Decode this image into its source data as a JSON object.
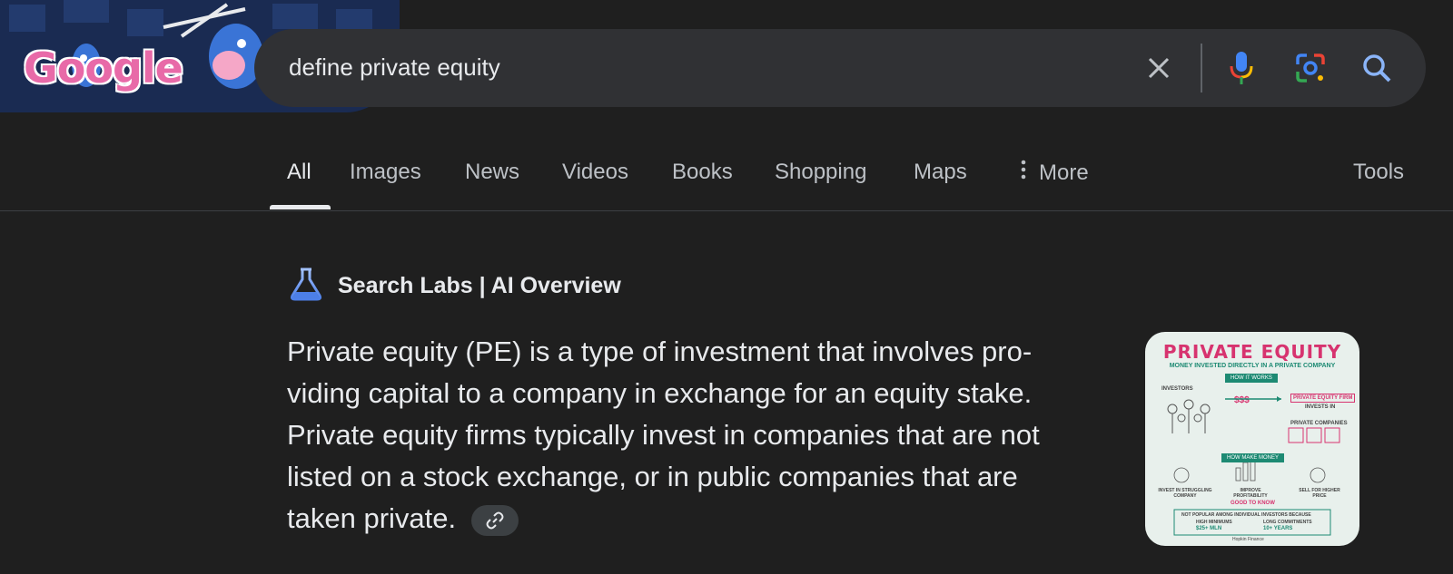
{
  "doodle": {
    "logo_text": "Google"
  },
  "search": {
    "query": "define private equity",
    "icons": [
      "close-icon",
      "microphone-icon",
      "lens-camera-icon",
      "search-icon"
    ]
  },
  "tabs": [
    {
      "label": "All",
      "active": true
    },
    {
      "label": "Images"
    },
    {
      "label": "News"
    },
    {
      "label": "Videos"
    },
    {
      "label": "Books"
    },
    {
      "label": "Shopping"
    },
    {
      "label": "Maps"
    },
    {
      "label": "More"
    }
  ],
  "tools_label": "Tools",
  "ai_overview": {
    "header": "Search Labs | AI Overview",
    "lines": [
      "Private equity (PE) is a type of investment that involves pro-",
      "viding capital to a company in exchange for an equity stake.",
      "Private equity firms typically invest in companies that are not",
      "listed on a stock exchange, or in public companies that are",
      "taken private."
    ],
    "image": {
      "title": "PRIVATE EQUITY",
      "subtitle": "MONEY INVESTED DIRECTLY IN A PRIVATE COMPANY",
      "how_it_works": "HOW IT WORKS",
      "investors": "INVESTORS",
      "money": "$$$",
      "firm": "PRIVATE EQUITY FIRM",
      "invests_in": "INVESTS IN",
      "private_companies": "PRIVATE COMPANIES",
      "how_make_money": "HOW MAKE MONEY",
      "step1": "INVEST IN STRUGGLING COMPANY",
      "step2": "IMPROVE PROFITABILITY",
      "step3": "SELL FOR HIGHER PRICE",
      "good_to_know": "GOOD TO KNOW",
      "note": "NOT POPULAR AMONG INDIVIDUAL INVESTORS BECAUSE",
      "high_minimums": "HIGH MINIMUMS",
      "high_minimums_value": "$25+ MLN",
      "long_commitments": "LONG COMMITMENTS",
      "long_commitments_value": "10+ YEARS",
      "credit": "Hopkin Finance"
    }
  },
  "colors": {
    "background": "#1f1f1f",
    "search_box": "#303134",
    "text": "#e8eaed",
    "muted": "#bdc1c6",
    "accent_pink": "#d7336f",
    "accent_teal": "#1d8a73"
  }
}
